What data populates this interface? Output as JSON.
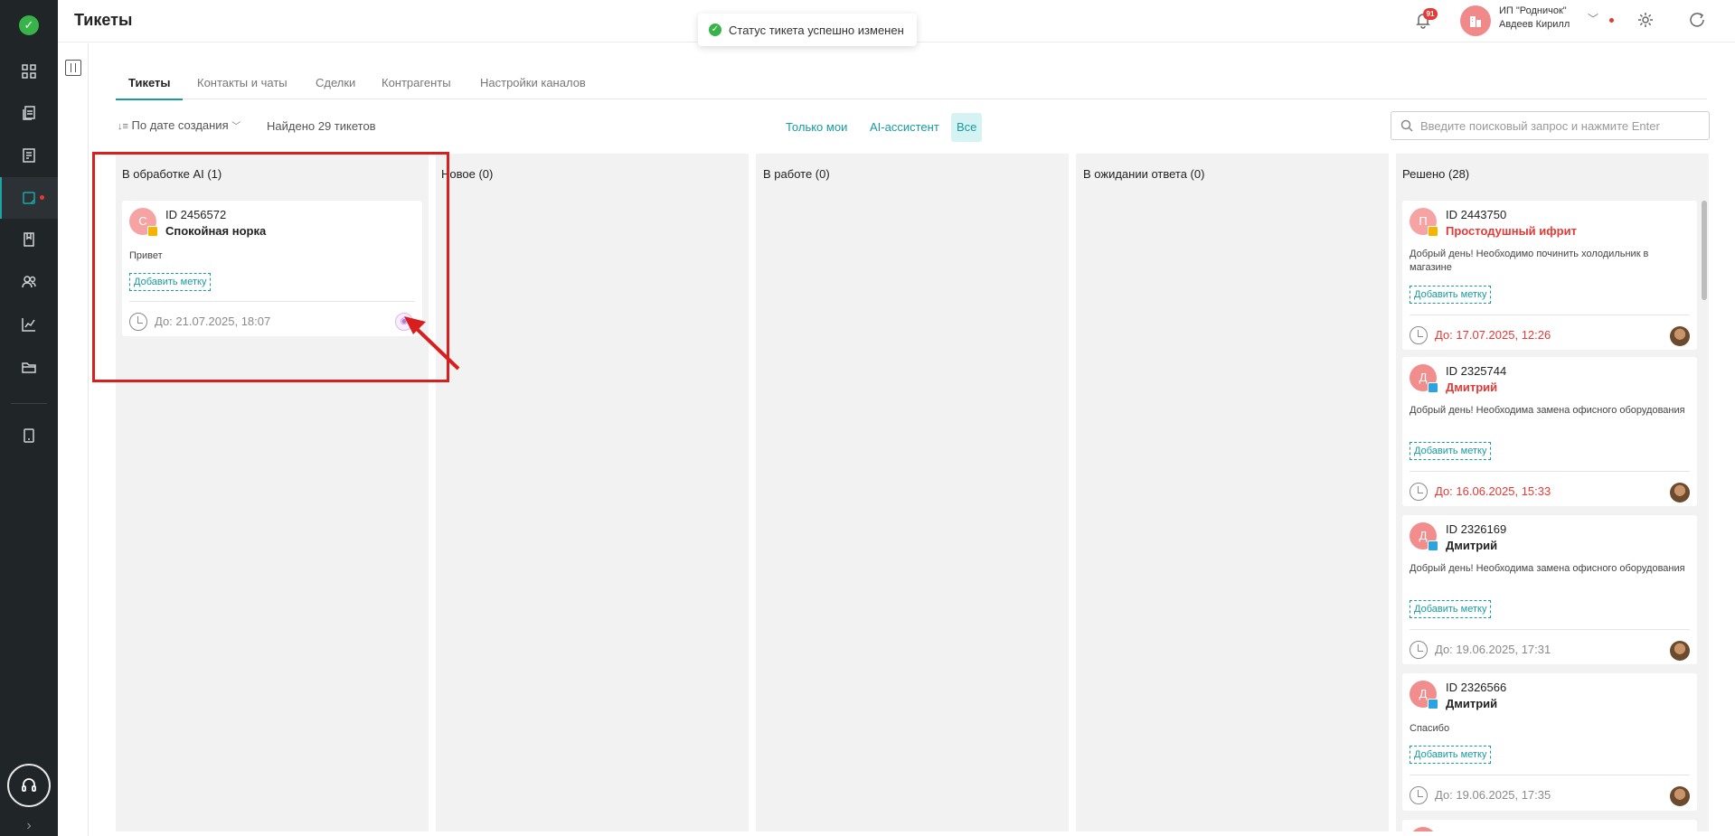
{
  "header": {
    "title": "Тикеты",
    "toast": "Статус тикета успешно изменен",
    "notifications_count": "91",
    "company_name": "ИП \"Родничок\"",
    "user_name": "Авдеев Кирилл"
  },
  "tabs": [
    "Тикеты",
    "Контакты и чаты",
    "Сделки",
    "Контрагенты",
    "Настройки каналов"
  ],
  "toolbar": {
    "sort_label": "По дате создания",
    "found_label": "Найдено 29 тикетов",
    "filters": [
      "Только мои",
      "AI-ассистент",
      "Все"
    ],
    "active_filter": "Все",
    "search_placeholder": "Введите поисковый запрос и нажмите Enter"
  },
  "columns": [
    {
      "title": "В обработке AI (1)",
      "cards": [
        {
          "avatar": "С",
          "channel": "chat",
          "id": "ID 2456572",
          "name": "Спокойная норка",
          "message": "Привет",
          "tag": "Добавить метку",
          "due": "До: 21.07.2025, 18:07",
          "overdue": false,
          "assignee": "ai"
        }
      ]
    },
    {
      "title": "Новое (0)",
      "cards": []
    },
    {
      "title": "В работе (0)",
      "cards": []
    },
    {
      "title": "В ожидании ответа (0)",
      "cards": []
    },
    {
      "title": "Решено (28)",
      "cards": [
        {
          "avatar": "П",
          "channel": "chat",
          "id": "ID 2443750",
          "name": "Простодушный ифрит",
          "message": "Добрый день! Необходимо починить холодильник в магазине",
          "tag": "Добавить метку",
          "due": "До: 17.07.2025, 12:26",
          "overdue": true,
          "assignee": "person"
        },
        {
          "avatar": "Д",
          "channel": "telegram",
          "id": "ID 2325744",
          "name": "Дмитрий",
          "message": "Добрый день! Необходима замена офисного оборудования",
          "tag": "Добавить метку",
          "due": "До: 16.06.2025, 15:33",
          "overdue": true,
          "assignee": "person"
        },
        {
          "avatar": "Д",
          "channel": "telegram",
          "id": "ID 2326169",
          "name": "Дмитрий",
          "message": "Добрый день! Необходима замена офисного оборудования",
          "tag": "Добавить метку",
          "due": "До: 19.06.2025, 17:31",
          "overdue": false,
          "assignee": "person"
        },
        {
          "avatar": "Д",
          "channel": "telegram",
          "id": "ID 2326566",
          "name": "Дмитрий",
          "message": "Спасибо",
          "tag": "Добавить метку",
          "due": "До: 19.06.2025, 17:35",
          "overdue": false,
          "assignee": "person"
        }
      ]
    }
  ],
  "icons": {
    "sidebar": [
      "dashboard-icon",
      "documents-icon",
      "reports-icon",
      "tickets-icon",
      "knowledge-base-icon",
      "users-icon",
      "analytics-icon",
      "folder-icon",
      "tablet-icon",
      "support-headset-icon"
    ]
  },
  "colors": {
    "accent": "#169ba0",
    "overdue": "#e53935",
    "success": "#37b34a",
    "sidebar": "#202528"
  }
}
